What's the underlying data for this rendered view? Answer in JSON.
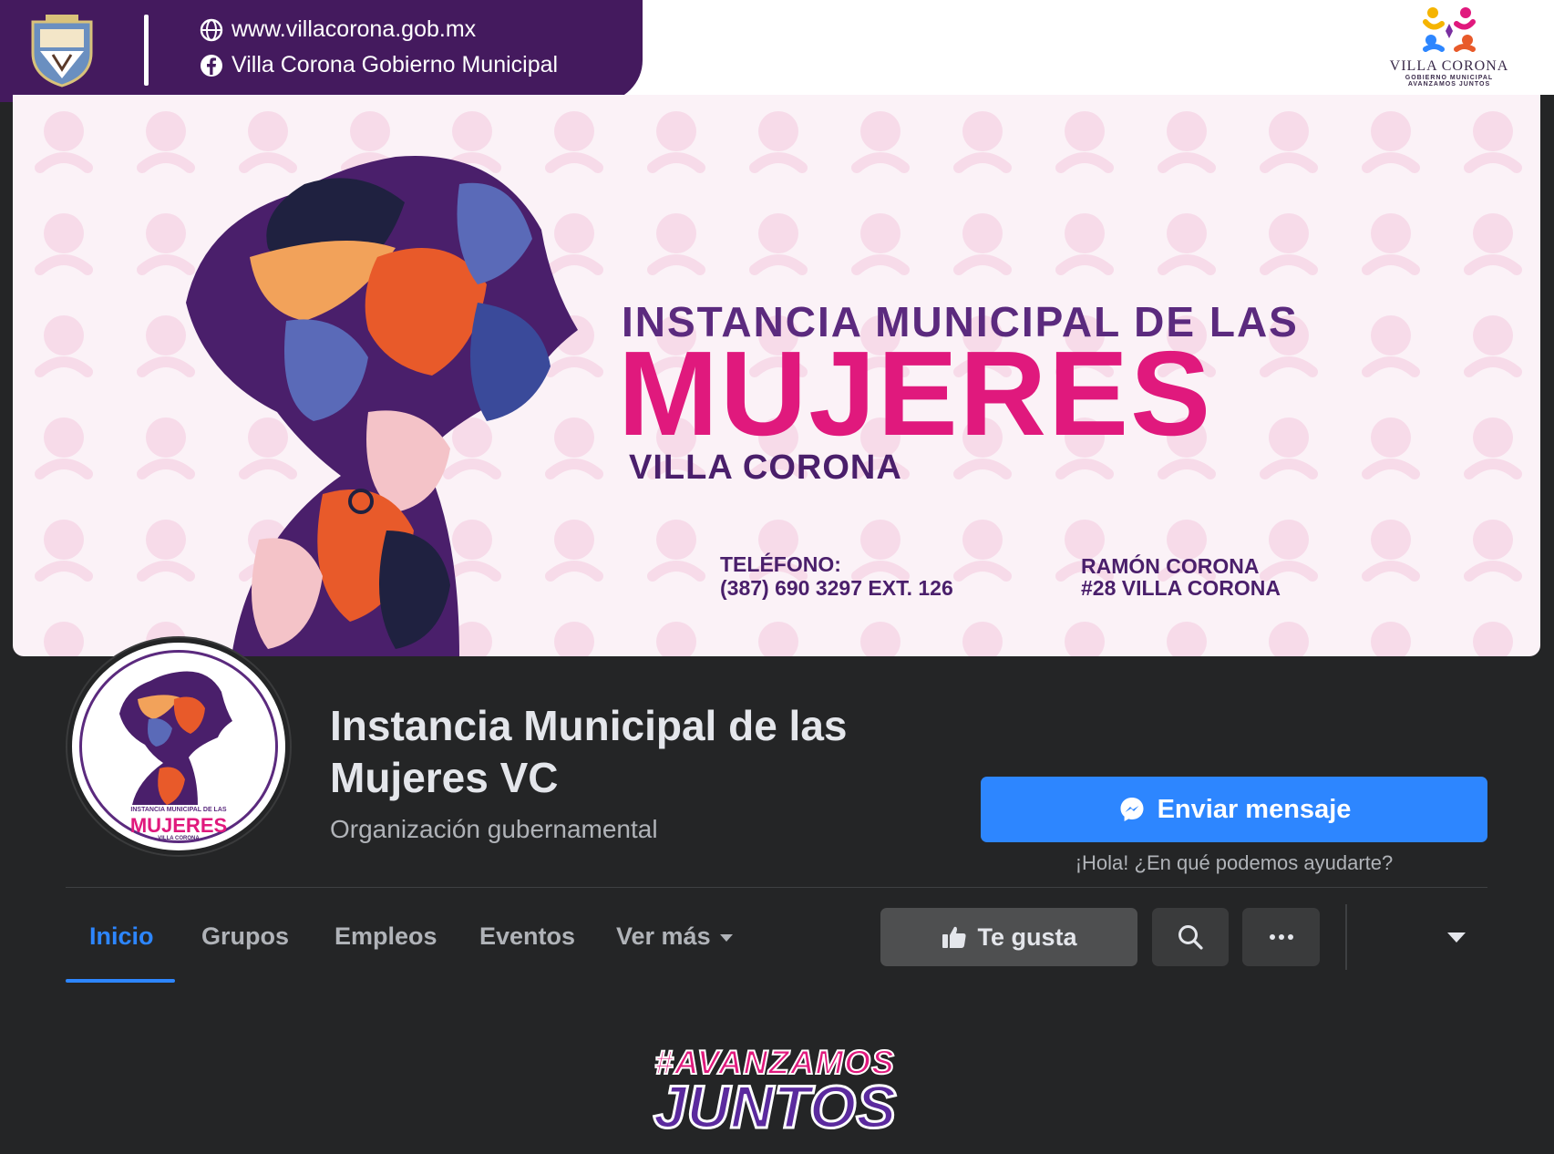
{
  "gov_header": {
    "website": "www.villacorona.gob.mx",
    "facebook": "Villa Corona Gobierno Municipal",
    "logo_name": "VILLA CORONA",
    "logo_subtitle": "GOBIERNO MUNICIPAL",
    "logo_tagline": "AVANZAMOS JUNTOS"
  },
  "cover": {
    "kicker": "INSTANCIA MUNICIPAL DE LAS",
    "title": "MUJERES",
    "subtitle": "VILLA CORONA",
    "phone_label": "TELÉFONO:",
    "phone": "(387) 690 3297 EXT. 126",
    "address_line1": "RAMÓN CORONA",
    "address_line2": "#28 VILLA CORONA"
  },
  "avatar": {
    "kicker": "INSTANCIA MUNICIPAL DE LAS",
    "title": "MUJERES",
    "subtitle": "VILLA CORONA"
  },
  "profile": {
    "name": "Instancia Municipal de las Mujeres VC",
    "category": "Organización gubernamental",
    "message_button": "Enviar mensaje",
    "message_hint": "¡Hola! ¿En qué podemos ayudarte?"
  },
  "tabs": [
    {
      "label": "Inicio",
      "active": true
    },
    {
      "label": "Grupos"
    },
    {
      "label": "Empleos"
    },
    {
      "label": "Eventos"
    },
    {
      "label": "Ver más"
    }
  ],
  "actions": {
    "like_label": "Te gusta"
  },
  "footer": {
    "slogan_line1": "#AVANZAMOS",
    "slogan_line2": "JUNTOS"
  },
  "colors": {
    "facebook_blue": "#2d86ff",
    "gov_purple": "#441a5e",
    "brand_pink": "#e0197d",
    "dark_bg": "#242526"
  },
  "icons": [
    "globe-icon",
    "facebook-icon",
    "messenger-icon",
    "thumbs-up-icon",
    "search-icon",
    "more-icon",
    "chevron-down-icon"
  ]
}
